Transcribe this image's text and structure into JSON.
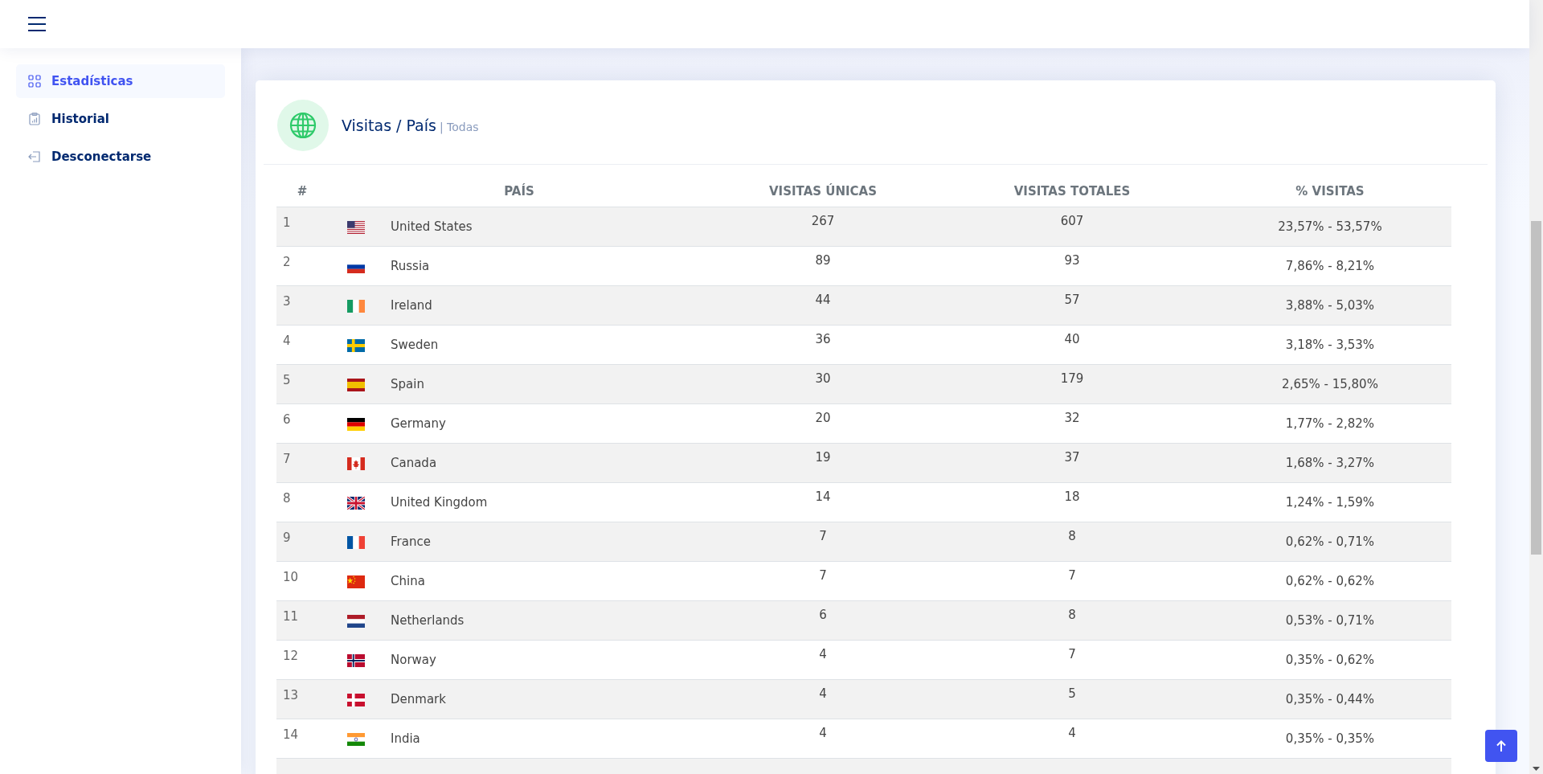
{
  "sidebar": {
    "items": [
      {
        "label": "Estadísticas",
        "selected": true
      },
      {
        "label": "Historial",
        "selected": false
      },
      {
        "label": "Desconectarse",
        "selected": false
      }
    ]
  },
  "card": {
    "title": "Visitas / País",
    "subtitle": "| Todas",
    "table": {
      "columns": [
        "#",
        "PAÍS",
        "VISITAS ÚNICAS",
        "VISITAS TOTALES",
        "% VISITAS"
      ],
      "rows": [
        {
          "rank": "1",
          "country": "United States",
          "unique": "267",
          "total": "607",
          "percent": "23,57% - 53,57%"
        },
        {
          "rank": "2",
          "country": "Russia",
          "unique": "89",
          "total": "93",
          "percent": "7,86% - 8,21%"
        },
        {
          "rank": "3",
          "country": "Ireland",
          "unique": "44",
          "total": "57",
          "percent": "3,88% - 5,03%"
        },
        {
          "rank": "4",
          "country": "Sweden",
          "unique": "36",
          "total": "40",
          "percent": "3,18% - 3,53%"
        },
        {
          "rank": "5",
          "country": "Spain",
          "unique": "30",
          "total": "179",
          "percent": "2,65% - 15,80%"
        },
        {
          "rank": "6",
          "country": "Germany",
          "unique": "20",
          "total": "32",
          "percent": "1,77% - 2,82%"
        },
        {
          "rank": "7",
          "country": "Canada",
          "unique": "19",
          "total": "37",
          "percent": "1,68% - 3,27%"
        },
        {
          "rank": "8",
          "country": "United Kingdom",
          "unique": "14",
          "total": "18",
          "percent": "1,24% - 1,59%"
        },
        {
          "rank": "9",
          "country": "France",
          "unique": "7",
          "total": "8",
          "percent": "0,62% - 0,71%"
        },
        {
          "rank": "10",
          "country": "China",
          "unique": "7",
          "total": "7",
          "percent": "0,62% - 0,62%"
        },
        {
          "rank": "11",
          "country": "Netherlands",
          "unique": "6",
          "total": "8",
          "percent": "0,53% - 0,71%"
        },
        {
          "rank": "12",
          "country": "Norway",
          "unique": "4",
          "total": "7",
          "percent": "0,35% - 0,62%"
        },
        {
          "rank": "13",
          "country": "Denmark",
          "unique": "4",
          "total": "5",
          "percent": "0,35% - 0,44%"
        },
        {
          "rank": "14",
          "country": "India",
          "unique": "4",
          "total": "4",
          "percent": "0,35% - 0,35%"
        }
      ]
    }
  }
}
